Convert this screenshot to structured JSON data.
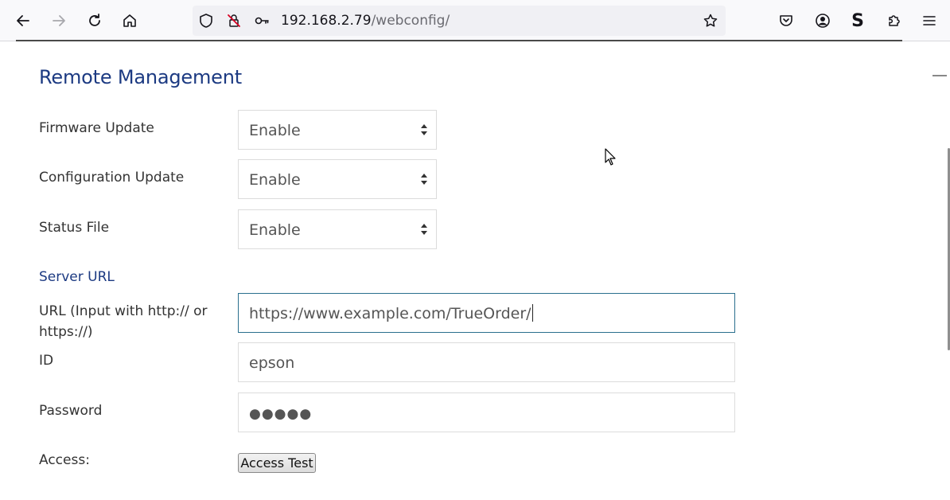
{
  "browser": {
    "url_host": "192.168.2.79",
    "url_path": "/webconfig/",
    "icons": [
      "back-icon",
      "forward-icon",
      "reload-icon",
      "home-icon",
      "shield-icon",
      "blocked-permission-icon",
      "key-icon",
      "bookmark-star-icon",
      "pocket-icon",
      "account-icon",
      "extension-s-icon",
      "extensions-puzzle-icon",
      "menu-icon"
    ],
    "s_letter": "S"
  },
  "page": {
    "section_title": "Remote Management",
    "fields": {
      "firmware_update": {
        "label": "Firmware Update",
        "value": "Enable"
      },
      "configuration_update": {
        "label": "Configuration Update",
        "value": "Enable"
      },
      "status_file": {
        "label": "Status File",
        "value": "Enable"
      }
    },
    "server_url_heading": "Server URL",
    "url_field": {
      "label_line1": "URL (Input with http:// or",
      "label_line2": "https://)",
      "value": "https://www.example.com/TrueOrder/"
    },
    "id_field": {
      "label": "ID",
      "value": "epson"
    },
    "password_field": {
      "label": "Password",
      "value": "●●●●●"
    },
    "access": {
      "label": "Access:",
      "button": "Access Test"
    }
  },
  "colors": {
    "heading": "#1c3a82",
    "focus_border": "#2a6f8e"
  }
}
